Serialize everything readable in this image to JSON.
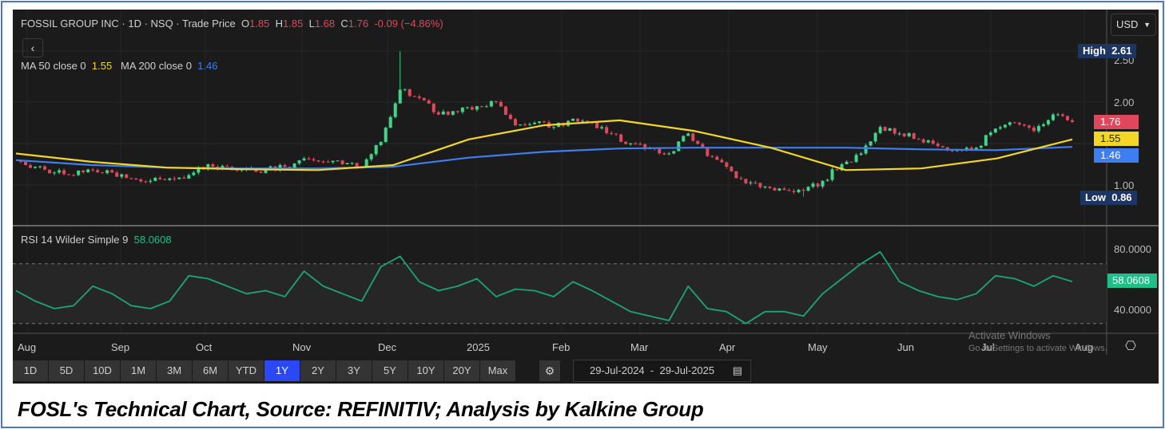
{
  "header": {
    "title": "FOSSIL GROUP INC · 1D · NSQ · Trade Price",
    "o_label": "O",
    "o": "1.85",
    "h_label": "H",
    "h": "1.85",
    "l_label": "L",
    "l": "1.68",
    "c_label": "C",
    "c": "1.76",
    "change": "-0.09 (−4.86%)"
  },
  "ma_legend": {
    "ma50_label": "MA 50 close 0",
    "ma50": "1.55",
    "ma200_label": "MA 200 close 0",
    "ma200": "1.46"
  },
  "rsi_legend": {
    "label": "RSI 14 Wilder Simple 9",
    "value": "58.0608"
  },
  "currency": "USD",
  "price_axis": {
    "ticks": [
      "2.50",
      "2.00",
      "1.00"
    ],
    "high_label": "High",
    "high": "2.61",
    "low_label": "Low",
    "low": "0.86",
    "last": "1.76",
    "ma50": "1.55",
    "ma200": "1.46"
  },
  "rsi_axis": {
    "ticks": [
      "80.0000",
      "40.0000"
    ],
    "last": "58.0608"
  },
  "time_axis": [
    "Aug",
    "Sep",
    "Oct",
    "Nov",
    "Dec",
    "2025",
    "Feb",
    "Mar",
    "Apr",
    "May",
    "Jun",
    "Jul",
    "Aug"
  ],
  "ranges": [
    "1D",
    "5D",
    "10D",
    "1M",
    "3M",
    "6M",
    "YTD",
    "1Y",
    "2Y",
    "3Y",
    "5Y",
    "10Y",
    "20Y",
    "Max"
  ],
  "active_range": "1Y",
  "date_from": "29-Jul-2024",
  "date_sep": "-",
  "date_to": "29-Jul-2025",
  "watermark": {
    "line1": "Activate Windows",
    "line2": "Go to Settings to activate Windows."
  },
  "caption": "FOSL's Technical Chart, Source: REFINITIV; Analysis by Kalkine Group",
  "colors": {
    "up": "#3ed68a",
    "down": "#e0475c",
    "ma50": "#f2d726",
    "ma200": "#3d7ef0",
    "rsi": "#1aa673",
    "active": "#2a48f5"
  },
  "chart_data": {
    "type": "candlestick",
    "title": "FOSSIL GROUP INC · 1D · NSQ",
    "price_range": [
      0.7,
      2.75
    ],
    "closes": [
      1.3,
      1.22,
      1.15,
      1.12,
      1.18,
      1.15,
      1.08,
      1.05,
      1.08,
      1.12,
      1.25,
      1.22,
      1.2,
      1.18,
      1.22,
      1.32,
      1.28,
      1.25,
      1.22,
      1.52,
      2.15,
      2.05,
      1.85,
      1.88,
      1.95,
      2.0,
      1.72,
      1.75,
      1.7,
      1.8,
      1.75,
      1.62,
      1.5,
      1.45,
      1.38,
      1.62,
      1.35,
      1.22,
      1.02,
      0.98,
      0.94,
      0.93,
      1.05,
      1.25,
      1.38,
      1.7,
      1.62,
      1.55,
      1.47,
      1.42,
      1.45,
      1.68,
      1.75,
      1.65,
      1.85,
      1.76
    ],
    "period_high": 2.61,
    "period_low": 0.86,
    "ma50": [
      1.38,
      1.28,
      1.21,
      1.19,
      1.18,
      1.24,
      1.55,
      1.72,
      1.78,
      1.65,
      1.45,
      1.18,
      1.2,
      1.32,
      1.55
    ],
    "ma200": [
      1.3,
      1.24,
      1.21,
      1.2,
      1.2,
      1.22,
      1.33,
      1.4,
      1.44,
      1.45,
      1.45,
      1.45,
      1.43,
      1.42,
      1.46
    ],
    "rsi": [
      52,
      45,
      40,
      42,
      55,
      50,
      42,
      40,
      45,
      62,
      60,
      55,
      50,
      52,
      48,
      65,
      55,
      50,
      45,
      68,
      75,
      58,
      52,
      55,
      60,
      48,
      53,
      52,
      48,
      58,
      52,
      45,
      38,
      35,
      32,
      55,
      40,
      38,
      30,
      38,
      38,
      35,
      50,
      60,
      70,
      78,
      58,
      52,
      48,
      46,
      50,
      62,
      60,
      55,
      62,
      58.06
    ],
    "rsi_range": [
      25,
      90
    ],
    "rsi_bands": [
      30,
      70
    ]
  }
}
